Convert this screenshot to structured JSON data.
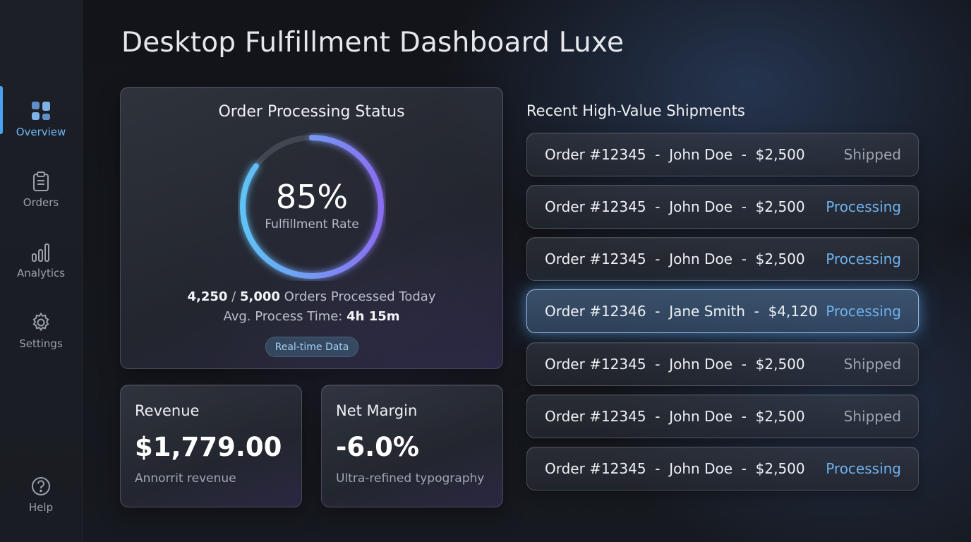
{
  "page": {
    "title": "Desktop Fulfillment Dashboard Luxe"
  },
  "sidebar": {
    "items": [
      {
        "label": "Overview",
        "icon": "grid-icon",
        "active": true
      },
      {
        "label": "Orders",
        "icon": "clipboard-icon"
      },
      {
        "label": "Analytics",
        "icon": "bar-chart-icon"
      },
      {
        "label": "Settings",
        "icon": "gear-icon"
      },
      {
        "label": "Help",
        "icon": "help-circle-icon"
      }
    ]
  },
  "status": {
    "title": "Order Processing Status",
    "rate_value": "85%",
    "rate_fraction": 0.85,
    "rate_label": "Fulfillment Rate",
    "processed": "4,250",
    "separator": "/",
    "total": "5,000",
    "processed_suffix": "Orders Processed Today",
    "avg_label": "Avg. Process Time:",
    "avg_value": "4h 15m",
    "badge": "Real-time Data"
  },
  "revenue": {
    "label": "Revenue",
    "value": "$1,779.00",
    "sub": "Annorrit revenue"
  },
  "margin": {
    "label": "Net Margin",
    "value": "-6.0%",
    "sub": "Ultra-refined typography"
  },
  "shipments": {
    "heading": "Recent High-Value Shipments",
    "rows": [
      {
        "description": "Order #12345  -  John Doe  -  $2,500",
        "status": "Shipped"
      },
      {
        "description": "Order #12345  -  John Doe  -  $2,500",
        "status": "Processing"
      },
      {
        "description": "Order #12345  -  John Doe  -  $2,500",
        "status": "Processing"
      },
      {
        "description": "Order #12346  -  Jane Smith  -  $4,120",
        "status": "Processing"
      },
      {
        "description": "Order #12345  -  John Doe  -  $2,500",
        "status": "Shipped"
      },
      {
        "description": "Order #12345  -  John Doe  -  $2,500",
        "status": "Shipped"
      },
      {
        "description": "Order #12345  -  John Doe  -  $2,500",
        "status": "Processing"
      }
    ]
  },
  "colors": {
    "accent": "#4aa3f2",
    "status_shipped": "#9ea5af",
    "status_processing": "#6fb1ee"
  }
}
